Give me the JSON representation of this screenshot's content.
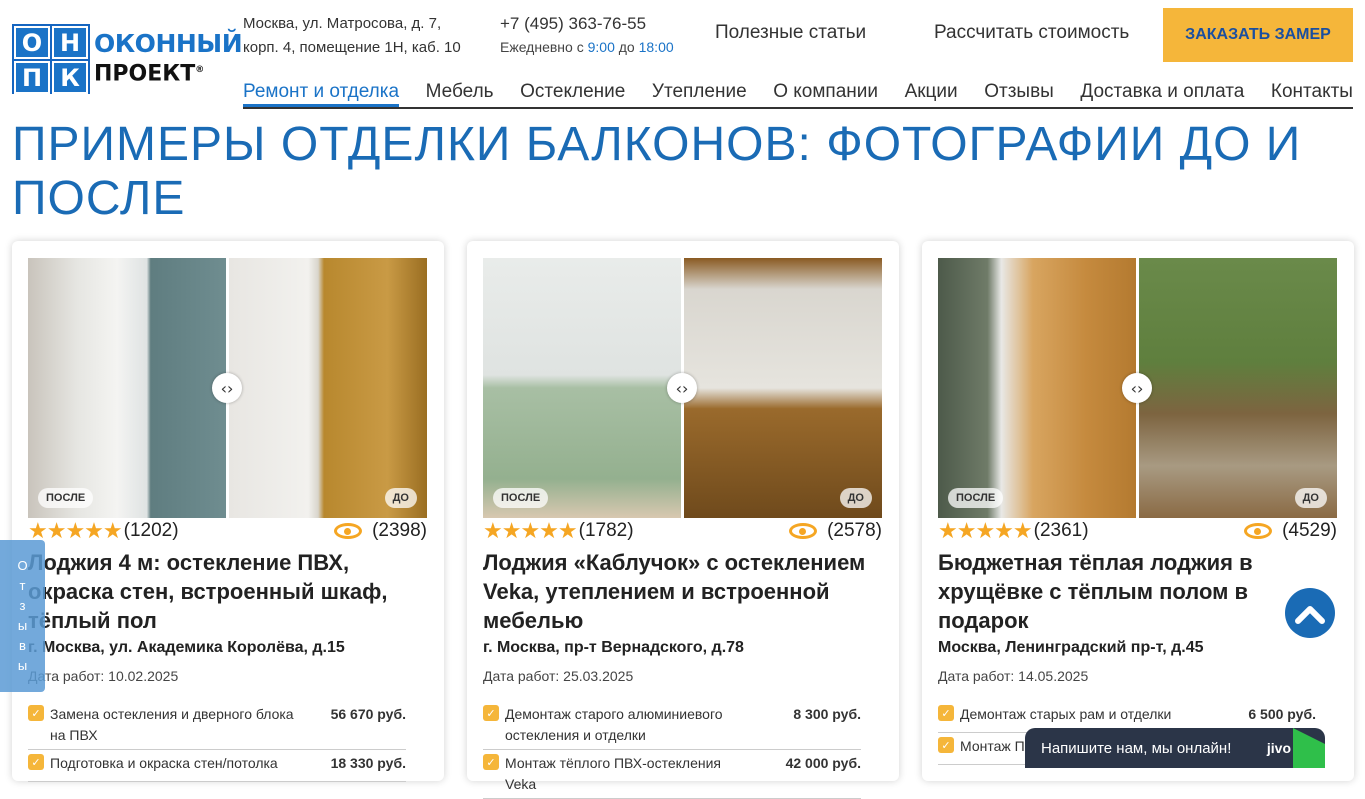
{
  "header": {
    "logo": {
      "letters": [
        "О",
        "Н",
        "П",
        "К"
      ],
      "line1": "ОКОННЫЙ",
      "line2": "ПРОЕКТ"
    },
    "address_line1": "Москва, ул. Матросова, д. 7,",
    "address_line2": "корп. 4, помещение 1Н, каб. 10",
    "phone": "+7 (495) 363-76-55",
    "hours_prefix": "Ежедневно с",
    "hours_from": "9:00",
    "hours_mid": "до",
    "hours_to": "18:00",
    "link_articles": "Полезные статьи",
    "link_calc": "Рассчитать стоимость",
    "order_button": "ЗАКАЗАТЬ ЗАМЕР"
  },
  "nav": [
    "Ремонт и отделка",
    "Мебель",
    "Остекление",
    "Утепление",
    "О компании",
    "Акции",
    "Отзывы",
    "Доставка и оплата",
    "Контакты"
  ],
  "page_title": "ПРИМЕРЫ ОТДЕЛКИ БАЛКОНОВ: ФОТОГРАФИИ ДО И ПОСЛЕ",
  "tags": {
    "after": "ПОСЛЕ",
    "before": "ДО"
  },
  "date_label": "Дата работ:",
  "cards": [
    {
      "rating_count": "(1202)",
      "views": "(2398)",
      "title": "Лоджия 4 м: остекление ПВХ, окраска стен, встроенный шкаф, тёплый пол",
      "location": "г. Москва, ул. Академика Королёва, д.15",
      "date": "10.02.2025",
      "works": [
        {
          "name": "Замена остекления и дверного блока на ПВХ",
          "price": "56 670 руб."
        },
        {
          "name": "Подготовка и окраска стен/потолка",
          "price": "18 330 руб."
        }
      ]
    },
    {
      "rating_count": "(1782)",
      "views": "(2578)",
      "title": "Лоджия «Каблучок» с остеклением Veka, утеплением и встроенной мебелью",
      "location": "г. Москва, пр-т Вернадского, д.78",
      "date": "25.03.2025",
      "works": [
        {
          "name": "Демонтаж старого алюминиевого остекления и отделки",
          "price": "8 300 руб."
        },
        {
          "name": "Монтаж тёплого ПВХ-остекления Veka",
          "price": "42 000 руб."
        }
      ]
    },
    {
      "rating_count": "(2361)",
      "views": "(4529)",
      "title": "Бюджетная тёплая лоджия в хрущёвке с тёплым полом в подарок",
      "location": "Москва, Ленинградский пр-т, д.45",
      "date": "14.05.2025",
      "works": [
        {
          "name": "Демонтаж старых рам и отделки",
          "price": "6 500 руб."
        },
        {
          "name": "Монтаж ПВХ",
          "price": ""
        }
      ]
    }
  ],
  "reviews_tab": "Отзывы",
  "chat": {
    "text": "Напишите нам, мы онлайн!",
    "brand": "jivo"
  },
  "colors": {
    "accent": "#1a6bb5",
    "button": "#f5b63a",
    "star": "#f5a623"
  }
}
